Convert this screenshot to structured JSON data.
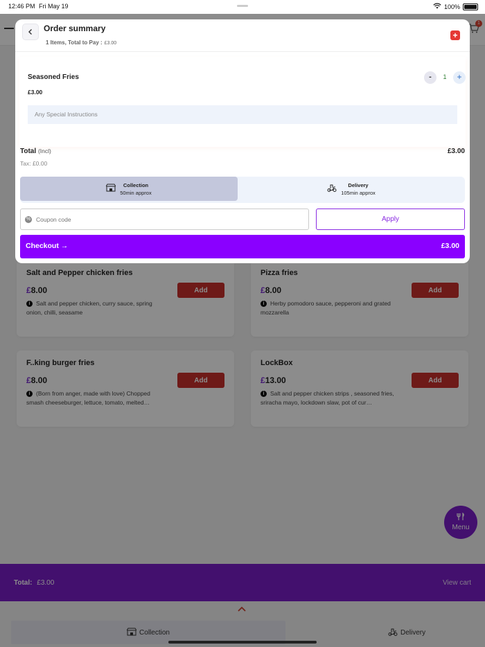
{
  "status": {
    "time": "12:46 PM",
    "date": "Fri May 19",
    "battery": "100%"
  },
  "page": {
    "cart_badge": "1"
  },
  "menu_items": [
    {
      "name": "Salt and Pepper chicken fries",
      "currency": "£",
      "price": "8.00",
      "add_label": "Add",
      "description": "Salt and pepper chicken, curry sauce, spring onion, chilli, seasame"
    },
    {
      "name": "Pizza fries",
      "currency": "£",
      "price": "8.00",
      "add_label": "Add",
      "description": "Herby pomodoro sauce, pepperoni and grated mozzarella"
    },
    {
      "name": "F..king burger fries",
      "currency": "£",
      "price": "8.00",
      "add_label": "Add",
      "description": "(Born from anger, made with love) Chopped smash cheeseburger, lettuce, tomato, melted…"
    },
    {
      "name": "LockBox",
      "currency": "£",
      "price": "13.00",
      "add_label": "Add",
      "description": "Salt and pepper chicken strips , seasoned fries, sriracha mayo, lockdown slaw, pot of cur…"
    }
  ],
  "menu_fab": {
    "label": "Menu"
  },
  "total_bar": {
    "label": "Total:",
    "amount": "£3.00",
    "view_cart": "View cart"
  },
  "bottom_tabs": {
    "collection": "Collection",
    "delivery": "Delivery"
  },
  "modal": {
    "title": "Order summary",
    "subtitle": "1 Items, Total to Pay :",
    "subtitle_amount": "£3.00",
    "item": {
      "name": "Seasoned Fries",
      "price": "£3.00",
      "quantity": "1",
      "minus": "-",
      "plus": "+",
      "instructions_placeholder": "Any Special Instructions"
    },
    "total_label": "Total",
    "total_incl": "(Incl)",
    "total_value": "£3.00",
    "tax": "Tax: £0.00",
    "modes": [
      {
        "name": "Collection",
        "time": "50min approx",
        "active": true
      },
      {
        "name": "Delivery",
        "time": "105min approx",
        "active": false
      }
    ],
    "coupon_placeholder": "Coupon code",
    "apply_label": "Apply",
    "checkout_label": "Checkout",
    "checkout_amount": "£3.00"
  },
  "colors": {
    "brand_purple": "#7a1ec9",
    "checkout_purple": "#8a00ff",
    "add_red": "#c9302c"
  }
}
